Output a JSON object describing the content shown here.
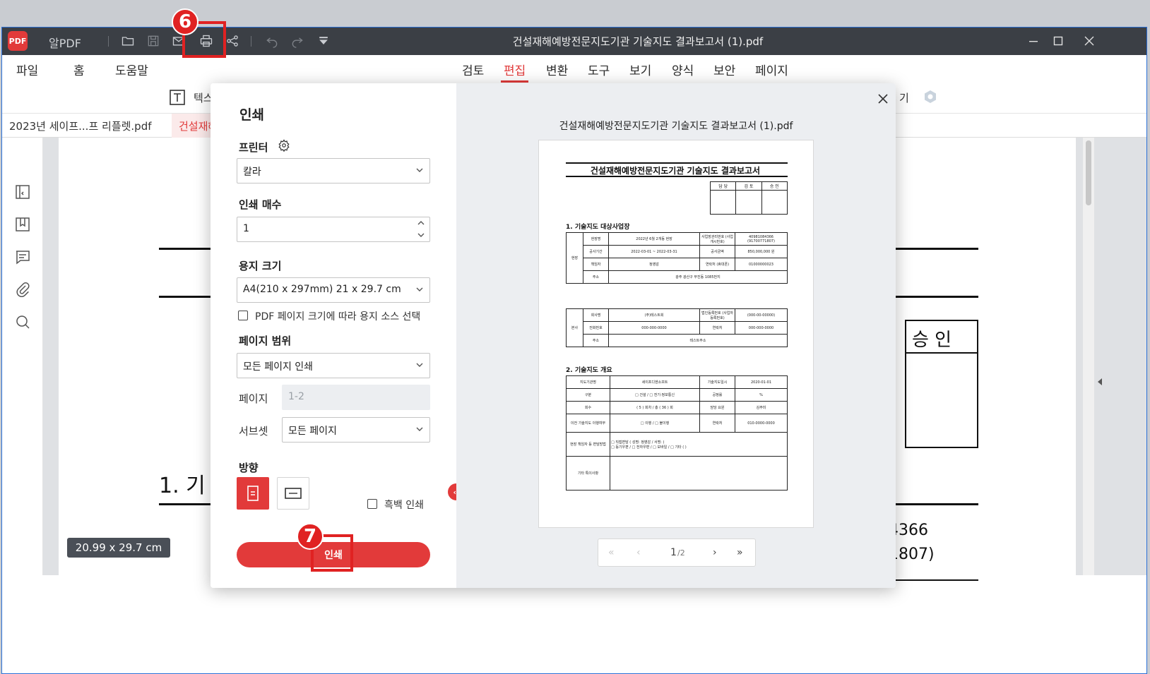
{
  "titlebar": {
    "app_name": "알PDF",
    "logo_text": "PDF",
    "doc_title": "건설재해예방전문지도기관 기술지도 결과보고서 (1).pdf"
  },
  "menu": {
    "left": [
      "파일",
      "홈",
      "도움말"
    ],
    "center": [
      "검토",
      "편집",
      "변환",
      "도구",
      "보기",
      "양식",
      "보안",
      "페이지"
    ],
    "active": "편집"
  },
  "ribbon": {
    "text_tool_label": "텍스",
    "right_partial": "기"
  },
  "tabs": [
    {
      "label": "2023년 세이프...프 리플렛.pdf",
      "active": false
    },
    {
      "label": "건설재해",
      "active": true
    }
  ],
  "document": {
    "approval_partial": "승 인",
    "section_partial": "1. 기",
    "value_partial_1": "4366",
    "value_partial_2": "1807)"
  },
  "status": {
    "page_size": "20.99 x 29.7 cm"
  },
  "dialog": {
    "title": "인쇄",
    "printer_label": "프린터",
    "printer_value": "칼라",
    "copies_label": "인쇄 매수",
    "copies_value": "1",
    "paper_label": "용지 크기",
    "paper_value": "A4(210 x 297mm) 21 x 29.7 cm",
    "paper_source_checkbox": "PDF 페이지 크기에 따라 용지 소스 선택",
    "range_label": "페이지 범위",
    "range_value": "모든 페이지 인쇄",
    "pages_label": "페이지",
    "pages_placeholder": "1-2",
    "subset_label": "서브셋",
    "subset_value": "모든 페이지",
    "orientation_label": "방향",
    "grayscale_label": "흑백 인쇄",
    "print_button": "인쇄",
    "divider_handle": "‹›"
  },
  "preview": {
    "title": "건설재해예방전문지도기관 기술지도 결과보고서 (1).pdf",
    "sheet_title": "건설재해예방전문지도기관 기술지도 결과보고서",
    "approval_headers": [
      "담 당",
      "검 토",
      "승 인"
    ],
    "section1": "1. 기술지도 대상사업장",
    "section2": "2. 기술지도 개요",
    "site_rows": [
      [
        "현장명",
        "2022년 6월 2개동 현장",
        "사업장관리번호 (사업개시번호)",
        "40981084366 (91700771807)"
      ],
      [
        "공사기간",
        "2022-03-01 ~ 2022-03-31",
        "공사금액",
        "850,000,000 원"
      ],
      [
        "책임자",
        "정영감",
        "연락처 (휴대폰)",
        "01000000023"
      ],
      [
        "주소",
        "광주 광산구 무진동 1085번지",
        "",
        ""
      ]
    ],
    "hq_rows": [
      [
        "회사명",
        "(주)테스트회",
        "법인등록번호 (사업자등록번호)",
        "(000-00-00000)"
      ],
      [
        "전화번호",
        "000-000-0000",
        "연락처",
        "000-000-0000"
      ],
      [
        "주소",
        "테스트주소",
        "",
        ""
      ]
    ],
    "side_labels": [
      "현장",
      "본사"
    ],
    "overview_rows": [
      [
        "지도기관명",
        "세이프디엔소프트",
        "기술지도일시",
        "2020-01-01"
      ],
      [
        "구분",
        "□ 건설 / □ 전기·정보통신",
        "공정률",
        "%"
      ],
      [
        "회수",
        "( 5 ) 회차 / 총 ( 36 ) 회",
        "담당 요원",
        "김주미"
      ],
      [
        "이전 기술지도 이행여부",
        "□ 이행 / □ 불이행",
        "연락처",
        "010-0000-0000"
      ],
      [
        "현장 책임자 등 면담방법",
        "□ 직접면담 ( 성명: 정영감 / 서명: )",
        "",
        ""
      ],
      [
        "기타 특이사항",
        "",
        "",
        ""
      ]
    ],
    "checkbox_note": "□ 등기우편 / □ 전자우편 / □ 모바일 / □ 기타 ( )"
  },
  "pager": {
    "first": "«",
    "prev": "‹",
    "current": "1",
    "total": "/2",
    "next": "›",
    "last": "»"
  },
  "annotations": {
    "step6": "6",
    "step7": "7"
  },
  "colors": {
    "accent": "#e23a3a",
    "titlebar": "#3b3f45",
    "annotation": "#e02222"
  }
}
